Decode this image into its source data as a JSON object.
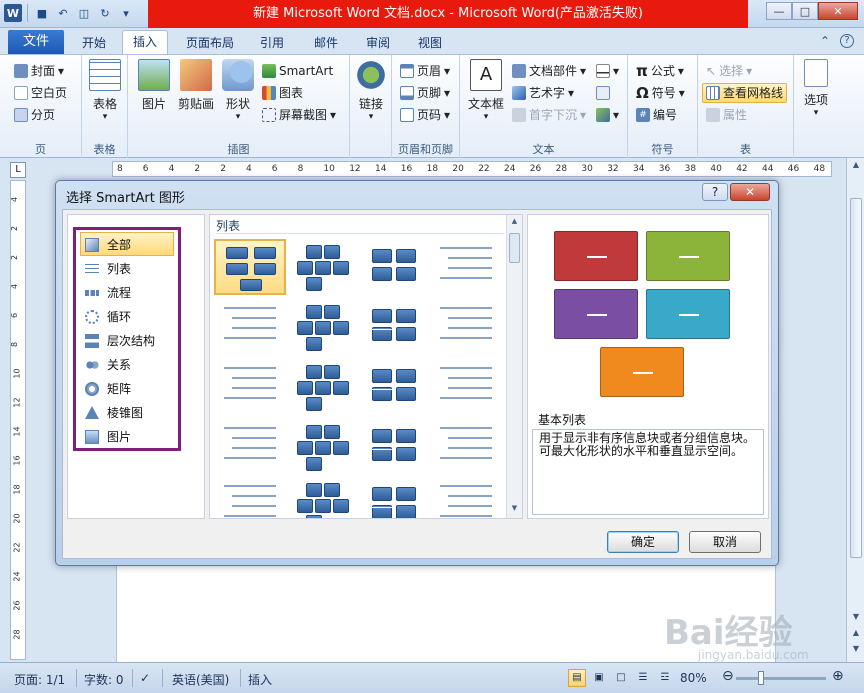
{
  "window": {
    "title": "新建 Microsoft Word 文档.docx - Microsoft Word(产品激活失败)"
  },
  "ribbon_tabs": {
    "file": "文件",
    "items": [
      "开始",
      "插入",
      "页面布局",
      "引用",
      "邮件",
      "审阅",
      "视图"
    ],
    "active": "插入"
  },
  "ribbon": {
    "pages": {
      "label": "页",
      "cover": "封面",
      "blank": "空白页",
      "break": "分页"
    },
    "table": {
      "label": "表格",
      "table": "表格"
    },
    "illustrations": {
      "label": "插图",
      "picture": "图片",
      "clipart": "剪贴画",
      "shapes": "形状",
      "smartart": "SmartArt",
      "chart": "图表",
      "screenshot": "屏幕截图"
    },
    "links": {
      "label": "链接"
    },
    "header_footer": {
      "label": "页眉和页脚",
      "header": "页眉",
      "footer": "页脚",
      "page_number": "页码"
    },
    "text": {
      "label": "文本",
      "textbox": "文本框",
      "quickparts": "文档部件",
      "wordart": "艺术字",
      "dropcap": "首字下沉"
    },
    "symbols": {
      "label": "符号",
      "equation": "公式",
      "symbol": "符号",
      "number": "编号"
    },
    "table_group": {
      "label": "表",
      "select": "选择",
      "gridlines": "查看网格线",
      "properties": "属性"
    },
    "options": {
      "label": "选项"
    }
  },
  "ruler": {
    "h_ticks": [
      "8",
      "6",
      "4",
      "2",
      "2",
      "4",
      "6",
      "8",
      "10",
      "12",
      "14",
      "16",
      "18",
      "20",
      "22",
      "24",
      "26",
      "28",
      "30",
      "32",
      "34",
      "36",
      "38",
      "40",
      "42",
      "44",
      "46",
      "48"
    ],
    "v_ticks": [
      "4",
      "2",
      "2",
      "4",
      "6",
      "8",
      "10",
      "12",
      "14",
      "16",
      "18",
      "20",
      "22",
      "24",
      "26",
      "28"
    ]
  },
  "dialog": {
    "title": "选择 SmartArt 图形",
    "help": "?",
    "categories": [
      {
        "label": "全部",
        "icon": "all-icon",
        "selected": true
      },
      {
        "label": "列表",
        "icon": "list-icon"
      },
      {
        "label": "流程",
        "icon": "process-icon"
      },
      {
        "label": "循环",
        "icon": "cycle-icon"
      },
      {
        "label": "层次结构",
        "icon": "hierarchy-icon"
      },
      {
        "label": "关系",
        "icon": "relationship-icon"
      },
      {
        "label": "矩阵",
        "icon": "matrix-icon"
      },
      {
        "label": "棱锥图",
        "icon": "pyramid-icon"
      },
      {
        "label": "图片",
        "icon": "picture-icon"
      }
    ],
    "gallery_heading": "列表",
    "preview": {
      "title": "基本列表",
      "description": "用于显示非有序信息块或者分组信息块。可最大化形状的水平和垂直显示空间。",
      "colors": [
        "#c0393b",
        "#8db43a",
        "#7a4fa3",
        "#38a9c8",
        "#f08a1e"
      ]
    },
    "ok": "确定",
    "cancel": "取消"
  },
  "statusbar": {
    "page": "页面: 1/1",
    "words": "字数: 0",
    "language": "英语(美国)",
    "mode": "插入",
    "zoom": "80%"
  },
  "watermark": {
    "text": "Bai经验",
    "url": "jingyan.baidu.com"
  }
}
